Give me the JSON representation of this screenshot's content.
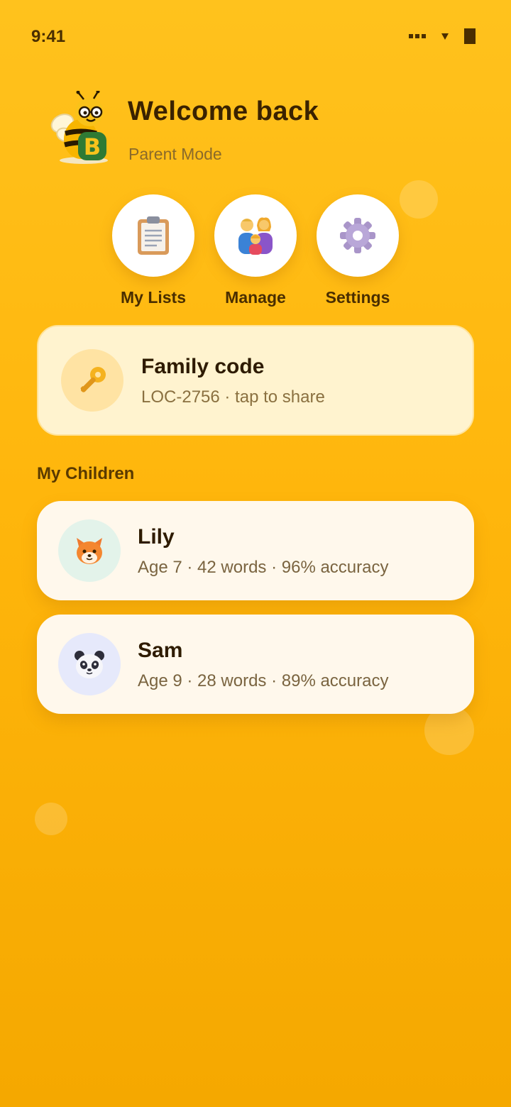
{
  "status_bar": {
    "time": "9:41"
  },
  "header": {
    "title": "Welcome back",
    "subtitle": "Parent Mode",
    "mascot_letter": "B"
  },
  "quick_actions": [
    {
      "label": "My Lists",
      "icon": "clipboard-icon"
    },
    {
      "label": "Manage",
      "icon": "family-icon"
    },
    {
      "label": "Settings",
      "icon": "gear-icon"
    }
  ],
  "family_code": {
    "title": "Family code",
    "subtitle": "LOC-2756 · tap to share",
    "icon": "key-icon"
  },
  "children_section": {
    "title": "My Children"
  },
  "children": [
    {
      "name": "Lily",
      "stats": "Age 7 · 42 words · 96% accuracy",
      "avatar": "fox-icon"
    },
    {
      "name": "Sam",
      "stats": "Age 9 · 28 words · 89% accuracy",
      "avatar": "panda-icon"
    }
  ],
  "colors": {
    "background": "#ffb60c",
    "card": "#fff8ec",
    "family_card": "#fff3cf",
    "text": "#3a2200"
  }
}
